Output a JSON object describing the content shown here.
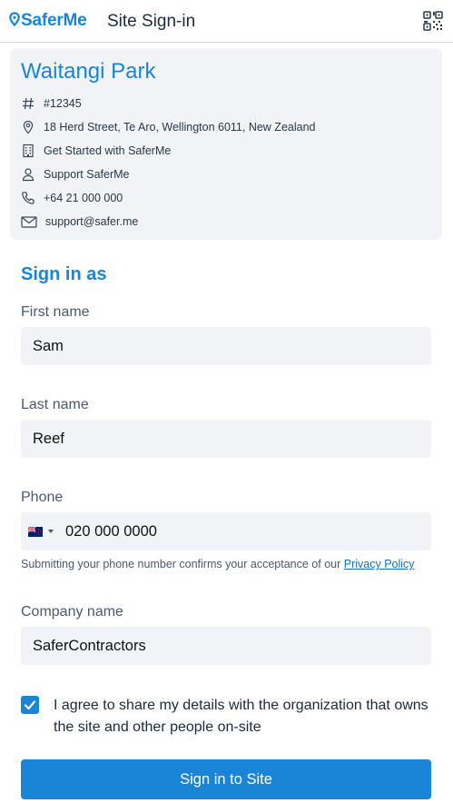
{
  "header": {
    "logo_text": "SaferMe",
    "title": "Site Sign-in",
    "qr_icon": "qr-code-icon"
  },
  "site": {
    "name": "Waitangi Park",
    "info": [
      {
        "icon": "hash-icon",
        "text": "#12345"
      },
      {
        "icon": "map-pin-icon",
        "text": "18 Herd Street, Te Aro, Wellington 6011, New Zealand"
      },
      {
        "icon": "building-icon",
        "text": "Get Started with SaferMe"
      },
      {
        "icon": "user-icon",
        "text": "Support SaferMe"
      },
      {
        "icon": "phone-icon",
        "text": "+64 21 000 000"
      },
      {
        "icon": "mail-icon",
        "text": "support@safer.me"
      }
    ]
  },
  "form": {
    "section_title": "Sign in as",
    "first_name": {
      "label": "First name",
      "value": "Sam"
    },
    "last_name": {
      "label": "Last name",
      "value": "Reef"
    },
    "phone": {
      "label": "Phone",
      "country": "New Zealand",
      "value": "020 000 0000",
      "note": "Submitting your phone number confirms your acceptance of our",
      "privacy_link": "Privacy Policy"
    },
    "company_name": {
      "label": "Company name",
      "value": "SaferContractors"
    },
    "agree": {
      "checked": true,
      "text": "I agree to share my details with the organization that owns the site and other people on-site"
    },
    "submit_label": "Sign in to Site"
  },
  "colors": {
    "accent": "#1a85d6",
    "field_bg": "#f1f3f6",
    "label": "#4a5a6e",
    "divider": "#d9dde2"
  }
}
